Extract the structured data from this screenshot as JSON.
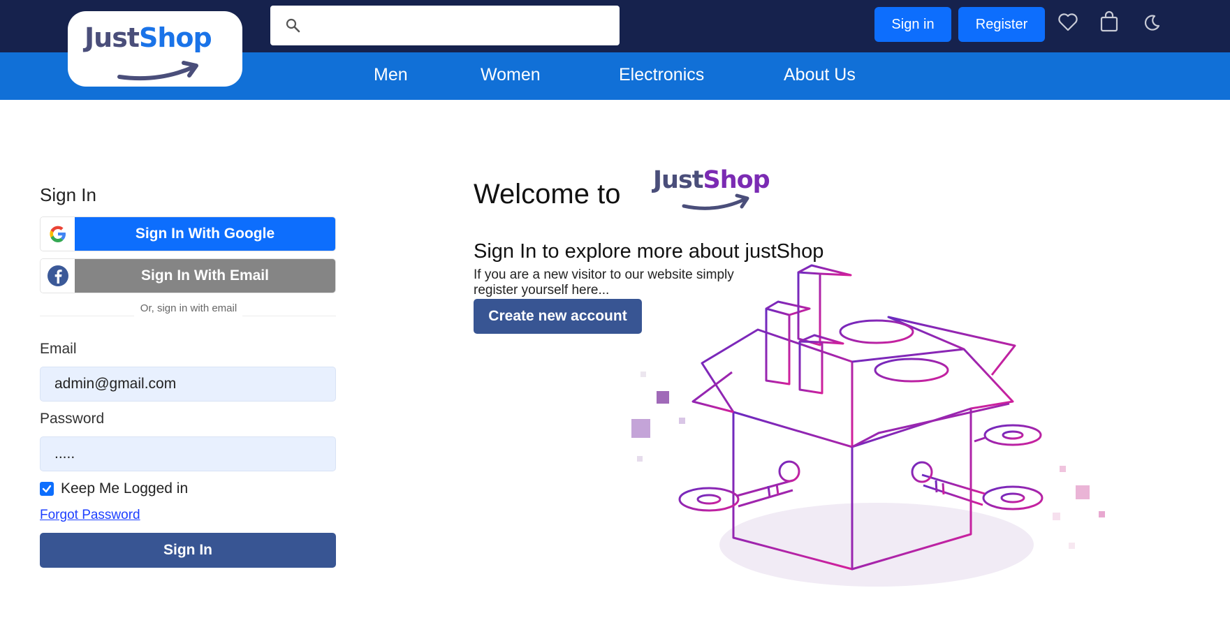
{
  "header": {
    "logo": {
      "part1": "Just",
      "part2": "Shop"
    },
    "search": {
      "placeholder": ""
    },
    "sign_in_label": "Sign in",
    "register_label": "Register"
  },
  "nav": {
    "items": [
      {
        "label": "Men"
      },
      {
        "label": "Women"
      },
      {
        "label": "Electronics"
      },
      {
        "label": "About Us"
      }
    ]
  },
  "signin_form": {
    "title": "Sign In",
    "google_label": "Sign In With Google",
    "email_method_label": "Sign In With Email",
    "divider_text": "Or, sign in with email",
    "email_label": "Email",
    "email_value": "admin@gmail.com",
    "password_label": "Password",
    "password_value": ".....",
    "keep_logged_in_label": "Keep Me Logged in",
    "keep_logged_in_checked": true,
    "forgot_label": "Forgot Password",
    "submit_label": "Sign In"
  },
  "welcome": {
    "title": "Welcome to",
    "brand_part1": "Just",
    "brand_part2": "Shop",
    "subheading": "Sign In to explore more about justShop",
    "description": "If you are a new visitor to our website simply register yourself here...",
    "create_account_label": "Create new account"
  },
  "colors": {
    "topbar": "#16224d",
    "navbar": "#1170d7",
    "primary": "#0d6efd",
    "dark_button": "#385593",
    "illustration_accent": "#c020a8"
  }
}
